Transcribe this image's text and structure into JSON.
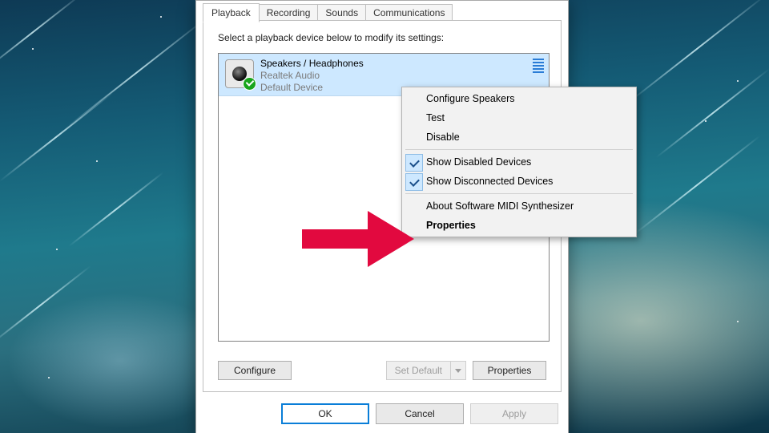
{
  "tabs": {
    "playback": "Playback",
    "recording": "Recording",
    "sounds": "Sounds",
    "communications": "Communications"
  },
  "instruction": "Select a playback device below to modify its settings:",
  "device": {
    "name": "Speakers / Headphones",
    "driver": "Realtek Audio",
    "status": "Default Device"
  },
  "buttons": {
    "configure": "Configure",
    "set_default": "Set Default",
    "properties": "Properties",
    "ok": "OK",
    "cancel": "Cancel",
    "apply": "Apply"
  },
  "context_menu": {
    "configure_speakers": "Configure Speakers",
    "test": "Test",
    "disable": "Disable",
    "show_disabled": "Show Disabled Devices",
    "show_disconnected": "Show Disconnected Devices",
    "about_midi": "About Software MIDI Synthesizer",
    "properties": "Properties"
  },
  "arrow_color": "#e2093f"
}
